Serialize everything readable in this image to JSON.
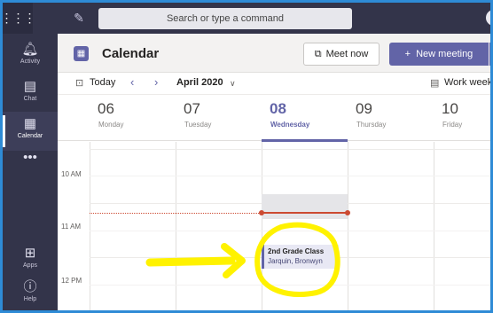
{
  "topbar": {
    "app_launcher_icon": "grid-dots-icon",
    "compose_icon": "compose-icon",
    "search_placeholder": "Search or type a command"
  },
  "rail": {
    "items": [
      {
        "label": "Activity",
        "icon": "bell-icon"
      },
      {
        "label": "Chat",
        "icon": "chat-icon"
      },
      {
        "label": "Calendar",
        "icon": "calendar-icon",
        "active": true
      },
      {
        "label": "",
        "icon": "more-icon"
      },
      {
        "label": "Apps",
        "icon": "apps-icon"
      },
      {
        "label": "Help",
        "icon": "help-icon"
      }
    ]
  },
  "header": {
    "title": "Calendar",
    "meet_now_label": "Meet now",
    "new_meeting_label": "New meeting"
  },
  "nav": {
    "today_label": "Today",
    "month_label": "April 2020",
    "view_label": "Work week"
  },
  "days": [
    {
      "num": "06",
      "name": "Monday"
    },
    {
      "num": "07",
      "name": "Tuesday"
    },
    {
      "num": "08",
      "name": "Wednesday",
      "today": true
    },
    {
      "num": "09",
      "name": "Thursday"
    },
    {
      "num": "10",
      "name": "Friday"
    }
  ],
  "times": [
    "10 AM",
    "11 AM",
    "12 PM"
  ],
  "event": {
    "title": "2nd Grade Class",
    "organizer": "Jarquin, Bronwyn"
  },
  "colors": {
    "brand": "#6264a7",
    "rail": "#33344a",
    "now_line": "#cc4a31",
    "annotation": "#fff200"
  }
}
